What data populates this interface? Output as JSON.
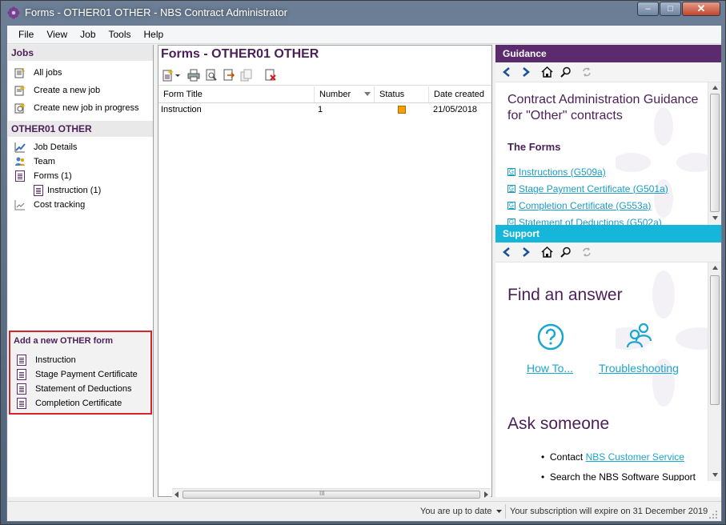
{
  "window": {
    "title": "Forms - OTHER01 OTHER - NBS Contract Administrator",
    "minimize_label": "–",
    "maximize_label": "□",
    "close_label": "✕"
  },
  "menu": [
    "File",
    "View",
    "Job",
    "Tools",
    "Help"
  ],
  "left": {
    "jobs_heading": "Jobs",
    "jobs_items": [
      "All jobs",
      "Create a new job",
      "Create new job in progress"
    ],
    "job_heading": "OTHER01 OTHER",
    "job_items": [
      "Job Details",
      "Team",
      "Forms (1)",
      "Instruction (1)",
      "Cost tracking"
    ],
    "add_heading": "Add a new OTHER form",
    "add_items": [
      "Instruction",
      "Stage Payment Certificate",
      "Statement of Deductions",
      "Completion Certificate"
    ]
  },
  "center": {
    "title": "Forms - OTHER01 OTHER",
    "columns": [
      "Form Title",
      "Number",
      "Status",
      "Date created"
    ],
    "rows": [
      {
        "title": "Instruction",
        "number": "1",
        "status_color": "#f5a000",
        "date": "21/05/2018"
      }
    ],
    "hscroll_glyph": "III"
  },
  "guidance": {
    "band": "Guidance",
    "band_color": "#5b2b6e",
    "heading": "Contract Administration Guidance for \"Other\" contracts",
    "subheading": "The Forms",
    "links": [
      "Instructions (G509a)",
      "Stage Payment Certificate (G501a)",
      "Completion Certificate (G553a)",
      "Statement of Deductions (G502a)"
    ]
  },
  "support": {
    "band": "Support",
    "band_color": "#15b6d9",
    "find_heading": "Find an answer",
    "how_to": "How To...",
    "troubleshooting": "Troubleshooting",
    "ask_heading": "Ask someone",
    "contact_prefix": "Contact ",
    "contact_link": "NBS Customer Service",
    "search_text": "Search the NBS Software Support"
  },
  "status": {
    "up_to_date": "You are up to date",
    "subscription": "Your subscription will expire on 31 December 2019"
  }
}
